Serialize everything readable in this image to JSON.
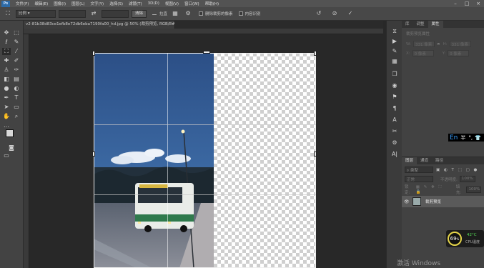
{
  "menubar": {
    "logo": "Ps",
    "items": [
      "文件(F)",
      "编辑(E)",
      "图像(I)",
      "图层(L)",
      "文字(Y)",
      "选择(S)",
      "滤镜(T)",
      "3D(D)",
      "视图(V)",
      "窗口(W)",
      "帮助(H)"
    ]
  },
  "options": {
    "ratio_select": "比例",
    "clear_button": "清除",
    "straighten_label": "拉直",
    "delete_cropped_label": "删除裁剪的像素",
    "content_aware_label": "内容识别"
  },
  "document": {
    "tab_title": "v2-81b38d83ce1efb8e72db6eba7190fa00_hd.jpg @ 50% (裁剪预览, RGB/8#) ×"
  },
  "panels": {
    "props_tabs": [
      "库",
      "调整",
      "属性"
    ],
    "props_header": "裁剪预览属性",
    "props_w_label": "W:",
    "props_w_value": "331 像素",
    "props_h_label": "H:",
    "props_h_value": "331 像素",
    "props_x_label": "X:",
    "props_x_value": "0 像素",
    "props_y_label": "Y:",
    "props_y_value": "0 像素",
    "layers_tabs": [
      "图层",
      "通道",
      "路径"
    ],
    "layers_kind": "类型",
    "layers_mode": "正常",
    "layers_opacity_label": "不透明度:",
    "layers_opacity_value": "100%",
    "layers_lock_label": "锁定:",
    "layers_fill_label": "填充:",
    "layers_fill_value": "100%",
    "layer_name": "裁剪预览"
  },
  "ime": {
    "lang": "En",
    "mode": "半"
  },
  "cpu": {
    "percent": "69",
    "unit": "%",
    "temp": "42°C",
    "label": "CPU温度"
  },
  "watermark": "激活 Windows",
  "colors": {
    "accent_blue": "#2d6aa6",
    "cpu_ring": "#e6d64a",
    "cpu_temp": "#55d655"
  }
}
